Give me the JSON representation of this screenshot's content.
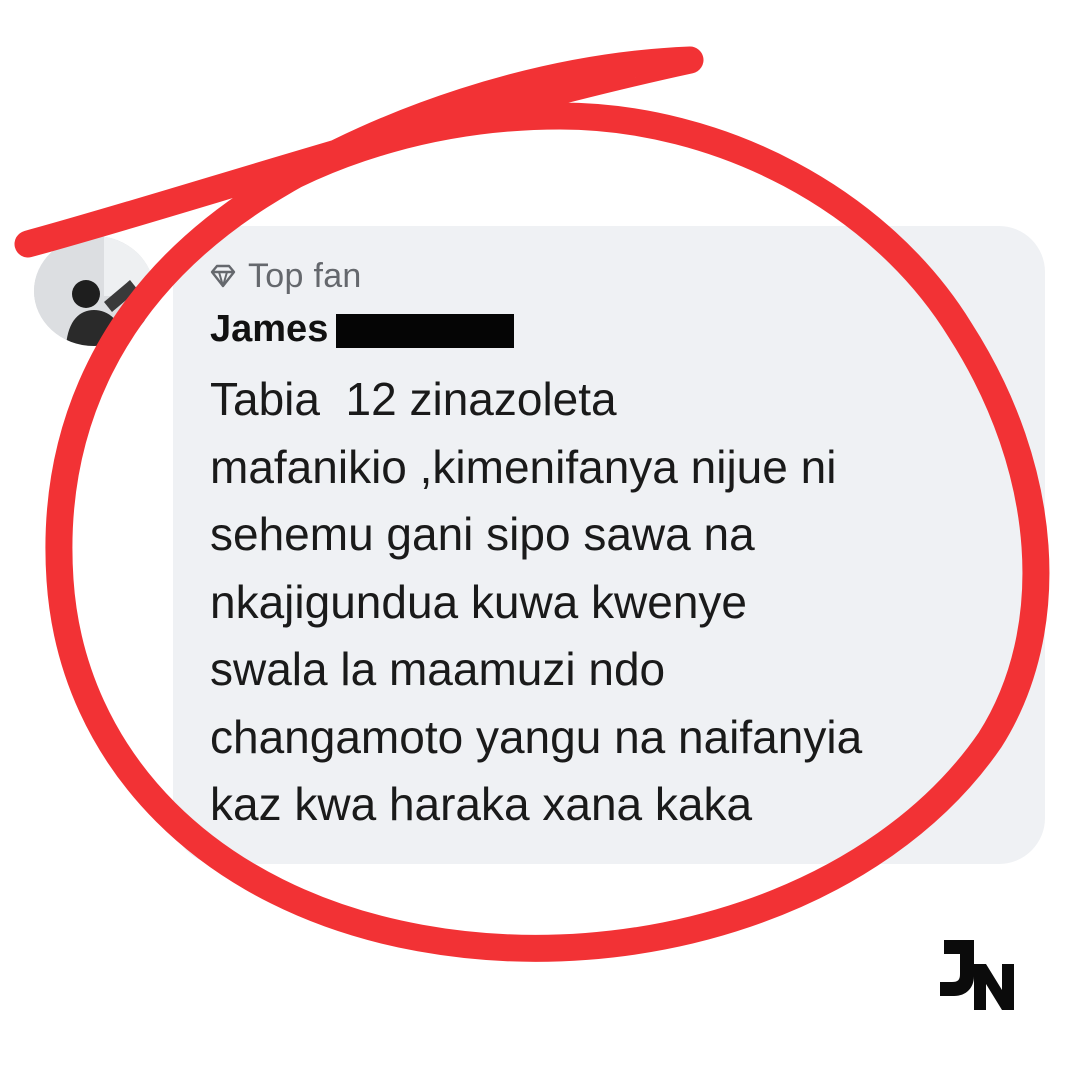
{
  "comment": {
    "badge": {
      "icon": "diamond-icon",
      "label": "Top fan"
    },
    "author": {
      "name": "James",
      "surname_redacted": true
    },
    "text_lines": [
      "Tabia  12 zinazoleta",
      "mafanikio ,kimenifanya nijue ni",
      "sehemu gani sipo sawa na",
      "nkajigundua kuwa kwenye",
      "swala la maamuzi ndo",
      "changamoto yangu na naifanyia",
      "kaz kwa haraka xana kaka"
    ]
  },
  "annotation": {
    "type": "hand-drawn circle",
    "color": "#f23235"
  },
  "brand": {
    "logo_text": "JN"
  },
  "colors": {
    "bubble": "#eff1f4",
    "badge_text": "#65686d",
    "text": "#1a1a1a"
  }
}
